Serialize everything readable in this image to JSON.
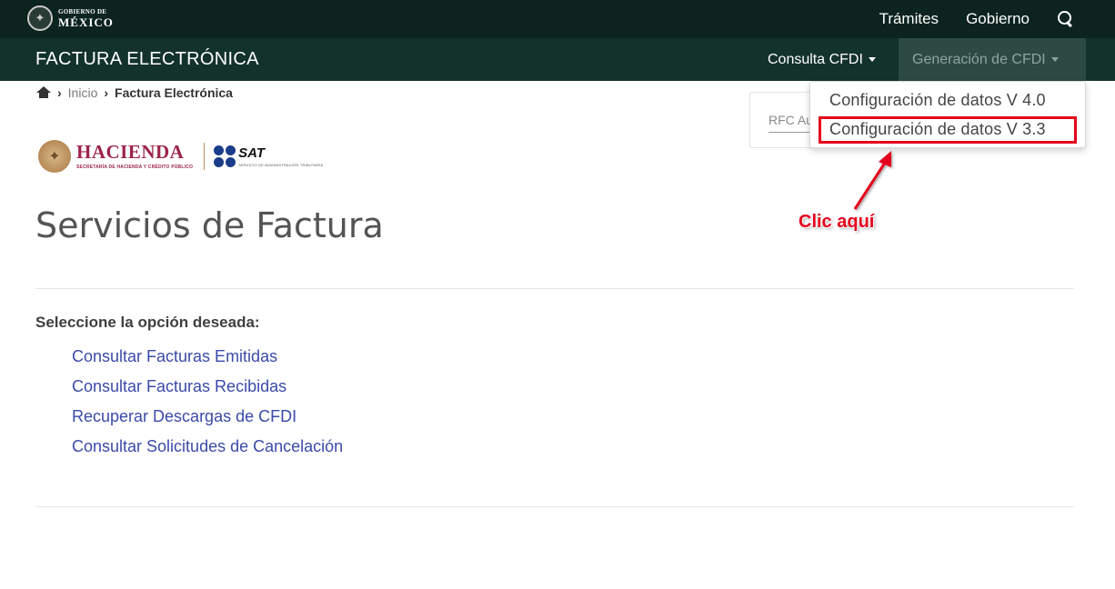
{
  "gov_header": {
    "logo_line1": "GOBIERNO DE",
    "logo_line2": "MÉXICO",
    "nav": [
      {
        "label": "Trámites"
      },
      {
        "label": "Gobierno"
      }
    ],
    "search_icon": "search-icon"
  },
  "app_header": {
    "title": "FACTURA ELECTRÓNICA",
    "menu_consulta": "Consulta CFDI",
    "menu_generacion": "Generación de CFDI"
  },
  "breadcrumb": {
    "home_icon": "home-icon",
    "inicio": "Inicio",
    "current": "Factura Electrónica"
  },
  "dropdown": {
    "items": [
      {
        "label": "Configuración de datos V 4.0"
      },
      {
        "label": "Configuración de datos V 3.3"
      }
    ]
  },
  "rfc_card": {
    "label": "RFC Au"
  },
  "annotation": {
    "text": "Clic aquí",
    "color": "#e3001b"
  },
  "logos": {
    "hacienda_title": "HACIENDA",
    "hacienda_subtitle": "SECRETARÍA DE HACIENDA Y CRÉDITO PÚBLICO",
    "sat_title": "SAT",
    "sat_subtitle": "SERVICIO DE ADMINISTRACIÓN TRIBUTARIA"
  },
  "main": {
    "title": "Servicios de Factura",
    "select_label": "Seleccione la opción deseada:",
    "options": [
      {
        "label": "Consultar Facturas Emitidas"
      },
      {
        "label": "Consultar Facturas Recibidas"
      },
      {
        "label": "Recuperar Descargas de CFDI"
      },
      {
        "label": "Consultar Solicitudes de Cancelación"
      }
    ]
  },
  "colors": {
    "gov_bar": "#0c231e",
    "app_bar": "#13322b",
    "link": "#3b4aa8",
    "hacienda": "#9d2449"
  }
}
